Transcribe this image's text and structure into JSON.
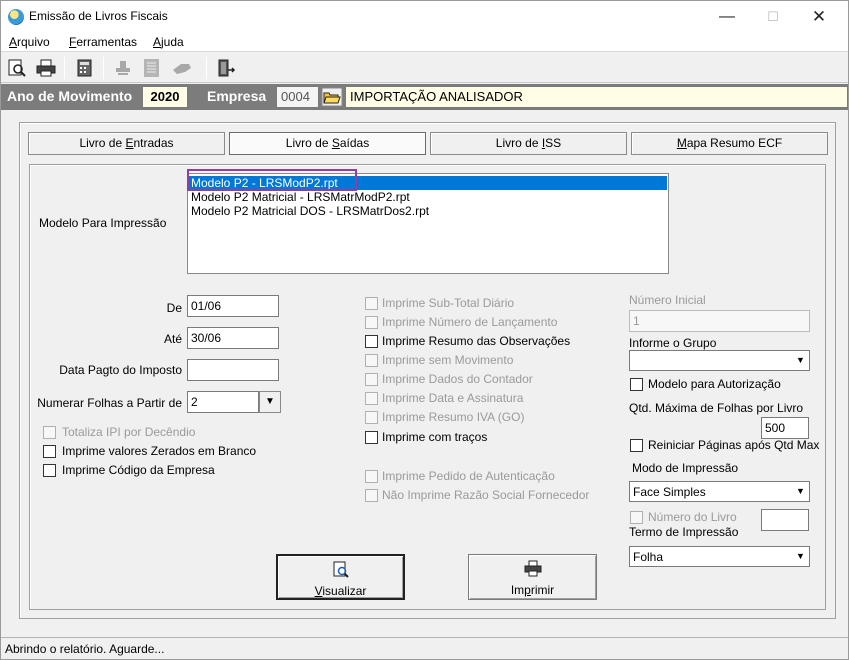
{
  "window": {
    "title": "Emissão de Livros Fiscais",
    "controls": {
      "minimize": "—",
      "maximize": "☐",
      "close": "✕"
    }
  },
  "menu": {
    "items": [
      {
        "first": "A",
        "rest": "rquivo"
      },
      {
        "first": "F",
        "rest": "erramentas"
      },
      {
        "first": "A",
        "rest": "juda"
      }
    ]
  },
  "toolbar": {
    "icons": [
      "preview-icon",
      "print-icon",
      "calculator-icon",
      "stamp-icon",
      "document-icon",
      "hand-icon",
      "exit-door-icon"
    ]
  },
  "header": {
    "year_label": "Ano de Movimento",
    "year_value": "2020",
    "company_label": "Empresa",
    "company_code": "0004",
    "company_name": "IMPORTAÇÃO ANALISADOR"
  },
  "tabs": [
    {
      "pre": "Livro de ",
      "key": "E",
      "post": "ntradas"
    },
    {
      "pre": "Livro de ",
      "key": "S",
      "post": "aídas"
    },
    {
      "pre": "Livro de ",
      "key": "I",
      "post": "SS"
    },
    {
      "pre": "",
      "key": "M",
      "post": "apa Resumo ECF"
    }
  ],
  "modelo": {
    "label": "Modelo Para Impressão",
    "items": [
      "Modelo P2 - LRSModP2.rpt",
      "Modelo P2 Matricial - LRSMatrModP2.rpt",
      "Modelo P2 Matricial DOS - LRSMatrDos2.rpt"
    ],
    "selected_index": 0
  },
  "fields": {
    "de_label": "De",
    "de_value": "01/06",
    "ate_label": "Até",
    "ate_value": "30/06",
    "pagto_label": "Data Pagto do Imposto",
    "pagto_value": "",
    "folhas_label": "Numerar Folhas a Partir de",
    "folhas_value": "2"
  },
  "left_checks": [
    {
      "label": "Totaliza IPI por Decêndio",
      "disabled": true
    },
    {
      "label": "Imprime valores Zerados em Branco",
      "disabled": false
    },
    {
      "label": "Imprime Código da Empresa",
      "disabled": false
    }
  ],
  "mid_checks": [
    {
      "label": "Imprime Sub-Total Diário",
      "disabled": true
    },
    {
      "label": "Imprime Número de Lançamento",
      "disabled": true
    },
    {
      "label": "Imprime Resumo das Observações",
      "disabled": false
    },
    {
      "label": "Imprime sem Movimento",
      "disabled": true
    },
    {
      "label": "Imprime Dados do Contador",
      "disabled": true
    },
    {
      "label": "Imprime Data e Assinatura",
      "disabled": true
    },
    {
      "label": "Imprime Resumo IVA (GO)",
      "disabled": true
    },
    {
      "label": "Imprime com traços",
      "disabled": false
    },
    {
      "label": "Imprime Pedido de Autenticação",
      "disabled": true
    },
    {
      "label": "Não Imprime Razão Social Fornecedor",
      "disabled": true
    }
  ],
  "right": {
    "numero_inicial_label": "Número Inicial",
    "numero_inicial_value": "1",
    "grupo_label": "Informe o Grupo",
    "grupo_value": "",
    "autorizacao_label": "Modelo para Autorização",
    "qtd_label": "Qtd. Máxima de Folhas por Livro",
    "qtd_value": "500",
    "reiniciar_label": "Reiniciar Páginas após Qtd Max",
    "modo_label": "Modo de Impressão",
    "modo_value": "Face Simples",
    "numero_livro_label": "Número do Livro",
    "numero_livro_value": "",
    "termo_label": "Termo de Impressão",
    "termo_value": "Folha"
  },
  "buttons": {
    "visualizar": {
      "key": "V",
      "rest": "isualizar"
    },
    "imprimir": {
      "pre": "Im",
      "key": "p",
      "rest": "rimir"
    }
  },
  "status": "Abrindo o relatório. Aguarde..."
}
